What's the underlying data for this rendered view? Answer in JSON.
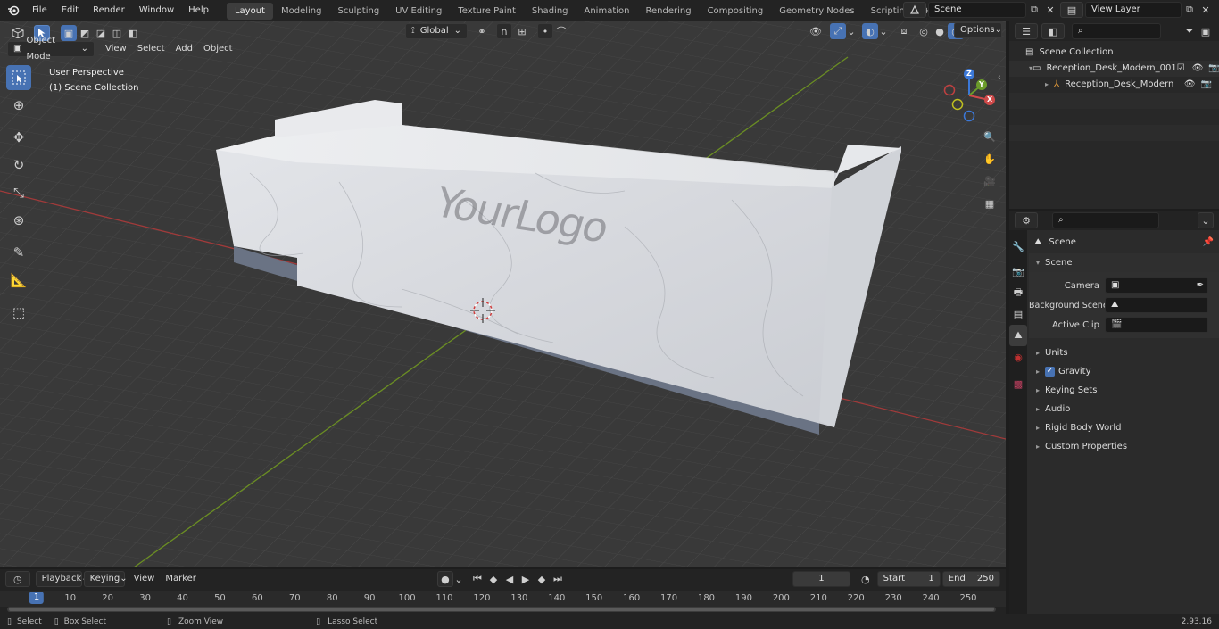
{
  "app": {
    "version": "2.93.16"
  },
  "menu": [
    "File",
    "Edit",
    "Render",
    "Window",
    "Help"
  ],
  "workspaces": [
    "Layout",
    "Modeling",
    "Sculpting",
    "UV Editing",
    "Texture Paint",
    "Shading",
    "Animation",
    "Rendering",
    "Compositing",
    "Geometry Nodes",
    "Scripting"
  ],
  "active_workspace": "Layout",
  "scene_field": "Scene",
  "view_layer_field": "View Layer",
  "viewport": {
    "mode": "Object Mode",
    "menus": [
      "View",
      "Select",
      "Add",
      "Object"
    ],
    "transform_orientation": "Global",
    "options_label": "Options",
    "overlay_text_1": "User Perspective",
    "overlay_text_2": "(1) Scene Collection",
    "logo_text": "YourLogo",
    "gizmo_axes": {
      "x": "X",
      "y": "Y",
      "z": "Z"
    }
  },
  "outliner": {
    "root": "Scene Collection",
    "items": [
      {
        "label": "Reception_Desk_Modern_001",
        "level": 1
      },
      {
        "label": "Reception_Desk_Modern",
        "level": 2
      }
    ]
  },
  "properties": {
    "header": "Scene",
    "section": "Scene",
    "fields": [
      {
        "label": "Camera",
        "value": ""
      },
      {
        "label": "Background Scene",
        "value": ""
      },
      {
        "label": "Active Clip",
        "value": ""
      }
    ],
    "subpanels": [
      "Units",
      "Gravity",
      "Keying Sets",
      "Audio",
      "Rigid Body World",
      "Custom Properties"
    ],
    "gravity_checked": true
  },
  "timeline": {
    "menus": [
      "Playback",
      "Keying",
      "View",
      "Marker"
    ],
    "current_frame": "1",
    "start_label": "Start",
    "start_value": "1",
    "end_label": "End",
    "end_value": "250",
    "ruler": [
      "1",
      "10",
      "20",
      "30",
      "40",
      "50",
      "60",
      "70",
      "80",
      "90",
      "100",
      "110",
      "120",
      "130",
      "140",
      "150",
      "160",
      "170",
      "180",
      "190",
      "200",
      "210",
      "220",
      "230",
      "240",
      "250"
    ]
  },
  "statusbar": {
    "items": [
      "Select",
      "Box Select",
      "Zoom View",
      "Lasso Select"
    ]
  },
  "colors": {
    "accent": "#4772b3",
    "x_axis": "#a03a3a",
    "y_axis": "#6b8e23"
  }
}
